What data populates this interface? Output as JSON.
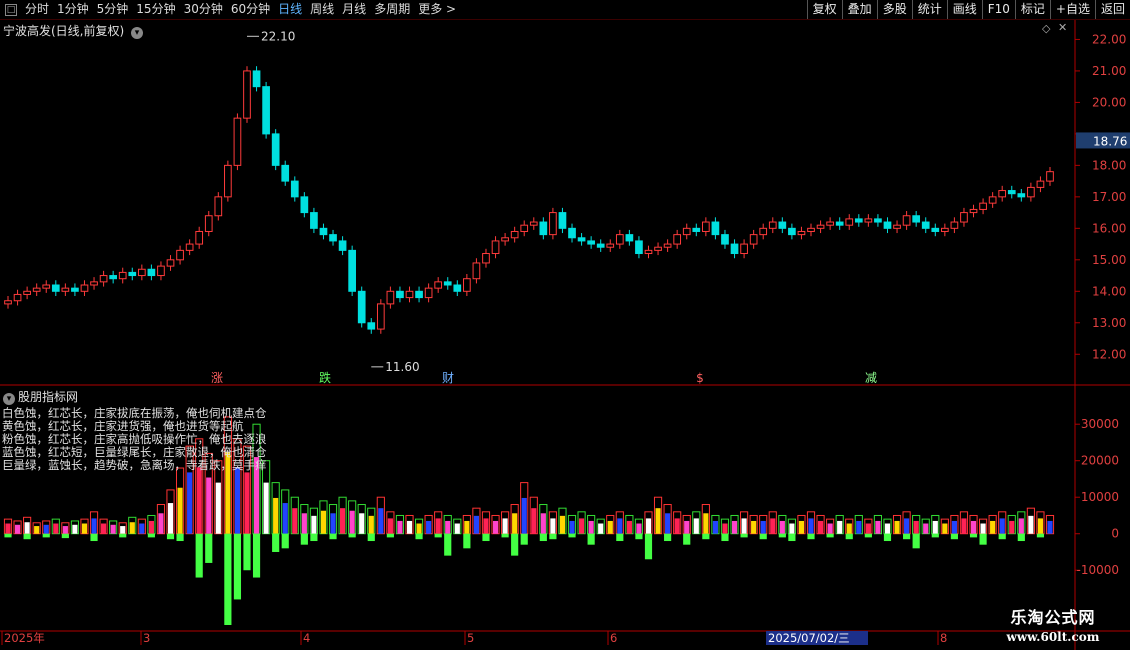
{
  "toolbar": {
    "tabs": [
      "分时",
      "1分钟",
      "5分钟",
      "15分钟",
      "30分钟",
      "60分钟",
      "日线",
      "周线",
      "月线",
      "多周期",
      "更多 >"
    ],
    "active_tab": "日线",
    "right_buttons": [
      "复权",
      "叠加",
      "多股",
      "统计",
      "画线",
      "F10",
      "标记",
      "+自选",
      "返回"
    ]
  },
  "main_chart": {
    "title": "宁波高发(日线,前复权)",
    "price_axis": [
      "22.00",
      "21.00",
      "20.00",
      "18.76",
      "18.00",
      "17.00",
      "16.00",
      "15.00",
      "14.00",
      "13.00",
      "12.00"
    ],
    "current_price": "18.76",
    "high_label": "22.10",
    "low_label": "11.60",
    "markers": [
      "涨",
      "跌",
      "财",
      "$",
      "减"
    ]
  },
  "indicator": {
    "title": "股朋指标网",
    "axis": [
      "30000",
      "20000",
      "10000",
      "0",
      "-10000"
    ],
    "legend": [
      "白色蚀，红芯长，庄家拔底在振荡，俺也伺机建点仓",
      "黄色蚀，红芯长，庄家进货强，俺也进货等起航",
      "粉色蚀，红芯长，庄家高抛低吸操作忙，俺也去逐浪",
      "蓝色蚀，红芯短，巨量绿尾长，庄家散退，俺也清仓",
      "巨量绿，蓝蚀长，趋势破，急离场，寺看跌，莫手痒"
    ]
  },
  "time_axis": [
    "2025年",
    "3",
    "4",
    "5",
    "6",
    "2025/07/02/三",
    "8"
  ],
  "watermark": {
    "line1": "乐淘公式网",
    "line2": "www.60lt.com"
  },
  "colors": {
    "up": "#ff3b3b",
    "down": "#00e0e0",
    "axis": "#c00000",
    "text": "#e0e0e0"
  },
  "chart_data": {
    "type": "candlestick",
    "title": "宁波高发(日线,前复权)",
    "ylim": [
      11.5,
      22.3
    ],
    "yticks": [
      12,
      13,
      14,
      15,
      16,
      17,
      18,
      19,
      20,
      21,
      22
    ],
    "high": 22.1,
    "low": 11.6,
    "last": 18.76,
    "closes": [
      13.7,
      13.9,
      14.0,
      14.1,
      14.2,
      14.0,
      14.1,
      14.0,
      14.2,
      14.3,
      14.5,
      14.4,
      14.6,
      14.5,
      14.7,
      14.5,
      14.8,
      15.0,
      15.3,
      15.5,
      15.9,
      16.4,
      17.0,
      18.0,
      19.5,
      21.0,
      20.5,
      19.0,
      18.0,
      17.5,
      17.0,
      16.5,
      16.0,
      15.8,
      15.6,
      15.3,
      14.0,
      13.0,
      12.8,
      13.6,
      14.0,
      13.8,
      14.0,
      13.8,
      14.1,
      14.3,
      14.2,
      14.0,
      14.4,
      14.9,
      15.2,
      15.6,
      15.7,
      15.9,
      16.1,
      16.2,
      15.8,
      16.5,
      16.0,
      15.7,
      15.6,
      15.5,
      15.4,
      15.5,
      15.8,
      15.6,
      15.2,
      15.3,
      15.4,
      15.5,
      15.8,
      16.0,
      15.9,
      16.2,
      15.8,
      15.5,
      15.2,
      15.5,
      15.8,
      16.0,
      16.2,
      16.0,
      15.8,
      15.9,
      16.0,
      16.1,
      16.2,
      16.1,
      16.3,
      16.2,
      16.3,
      16.2,
      16.0,
      16.1,
      16.4,
      16.2,
      16.0,
      15.9,
      16.0,
      16.2,
      16.5,
      16.6,
      16.8,
      17.0,
      17.2,
      17.1,
      17.0,
      17.3,
      17.5,
      17.8
    ],
    "indicator": {
      "type": "bar",
      "ylim": [
        -25000,
        38000
      ],
      "yticks": [
        30000,
        20000,
        10000,
        0,
        -10000
      ],
      "values": [
        4000,
        3500,
        4500,
        3000,
        3500,
        4000,
        3000,
        3500,
        4000,
        6000,
        4000,
        3500,
        3000,
        4500,
        4000,
        5000,
        8000,
        12000,
        18000,
        24000,
        26000,
        22000,
        20000,
        32000,
        26000,
        24000,
        30000,
        20000,
        14000,
        12000,
        10000,
        8000,
        7000,
        9000,
        8000,
        10000,
        9000,
        8000,
        7000,
        10000,
        6000,
        5000,
        5000,
        4000,
        5000,
        6000,
        5000,
        4000,
        5000,
        7000,
        6000,
        5000,
        6000,
        8000,
        14000,
        10000,
        8000,
        6000,
        7000,
        5000,
        6000,
        5000,
        4000,
        5000,
        6000,
        5000,
        4000,
        6000,
        10000,
        8000,
        6000,
        5000,
        6000,
        8000,
        5000,
        4000,
        5000,
        6000,
        5000,
        5000,
        6000,
        5000,
        4000,
        5000,
        6000,
        5000,
        4000,
        5000,
        4000,
        5000,
        4000,
        5000,
        4000,
        5000,
        6000,
        5000,
        4000,
        5000,
        4000,
        5000,
        6000,
        5000,
        4000,
        5000,
        6000,
        5000,
        6000,
        7000,
        6000,
        5000
      ],
      "negative": [
        -1000,
        0,
        -1500,
        0,
        -1000,
        0,
        -1200,
        0,
        0,
        -2000,
        0,
        0,
        -1000,
        0,
        0,
        -1000,
        0,
        -1500,
        -2000,
        0,
        -12000,
        -8000,
        0,
        -25000,
        -18000,
        -10000,
        -12000,
        0,
        -5000,
        -4000,
        0,
        -3000,
        -2000,
        0,
        -1500,
        0,
        -1000,
        0,
        -2000,
        0,
        -1000,
        0,
        0,
        -1500,
        0,
        -1000,
        -6000,
        0,
        -4000,
        0,
        -2000,
        0,
        -1000,
        -6000,
        -3000,
        0,
        -2000,
        -1500,
        0,
        -1000,
        0,
        -3000,
        0,
        0,
        -2000,
        0,
        -1500,
        -7000,
        0,
        -2000,
        0,
        -3000,
        0,
        -1500,
        0,
        -2000,
        0,
        -1000,
        0,
        -1500,
        0,
        -1000,
        -2000,
        0,
        -1500,
        0,
        -1000,
        0,
        -1500,
        0,
        -1000,
        0,
        -2000,
        0,
        -1500,
        -4000,
        0,
        -1000,
        0,
        -1500,
        0,
        -1000,
        -3000,
        0,
        -1500,
        0,
        -2000,
        0,
        -1000,
        0
      ]
    }
  }
}
